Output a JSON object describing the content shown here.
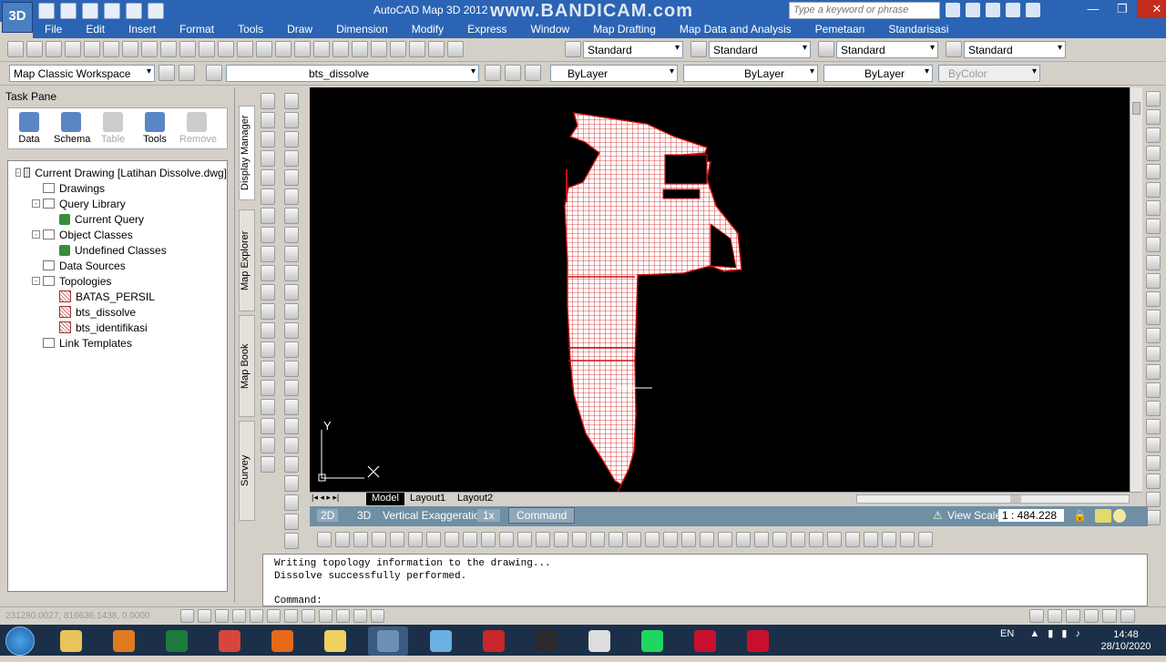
{
  "title_bar": {
    "app_title": "AutoCAD Map 3D 2012",
    "logo": "3D",
    "watermark": "www.BANDICAM.com",
    "search_placeholder": "Type a keyword or phrase"
  },
  "menu": [
    "File",
    "Edit",
    "Insert",
    "Format",
    "Tools",
    "Draw",
    "Dimension",
    "Modify",
    "Express",
    "Window",
    "Map Drafting",
    "Map Data and Analysis",
    "Pemetaan",
    "Standarisasi"
  ],
  "toolbar1": {
    "text_style": "Standard",
    "dim_style": "Standard",
    "table_style": "Standard",
    "mleader_style": "Standard"
  },
  "toolbar2": {
    "workspace": "Map Classic Workspace",
    "layer": "bts_dissolve",
    "color": "ByLayer",
    "linetype": "ByLayer",
    "lineweight": "ByLayer",
    "plotstyle": "ByColor"
  },
  "task_pane": {
    "title": "Task Pane",
    "icons": [
      {
        "label": "Data",
        "enabled": true
      },
      {
        "label": "Schema",
        "enabled": true
      },
      {
        "label": "Table",
        "enabled": false
      },
      {
        "label": "Tools",
        "enabled": true
      },
      {
        "label": "Remove",
        "enabled": false
      }
    ],
    "tree": [
      {
        "label": "Current Drawing [Latihan Dissolve.dwg]",
        "level": 0,
        "expander": "-",
        "icon": "drawing-icon"
      },
      {
        "label": "Drawings",
        "level": 1,
        "expander": "",
        "icon": "folder-icon"
      },
      {
        "label": "Query Library",
        "level": 1,
        "expander": "-",
        "icon": "folder-icon"
      },
      {
        "label": "Current Query",
        "level": 2,
        "expander": "",
        "icon": "query-icon"
      },
      {
        "label": "Object Classes",
        "level": 1,
        "expander": "-",
        "icon": "folder-icon"
      },
      {
        "label": "Undefined Classes",
        "level": 2,
        "expander": "",
        "icon": "query-icon"
      },
      {
        "label": "Data Sources",
        "level": 1,
        "expander": "",
        "icon": "folder-icon"
      },
      {
        "label": "Topologies",
        "level": 1,
        "expander": "-",
        "icon": "folder-icon"
      },
      {
        "label": "BATAS_PERSIL",
        "level": 2,
        "expander": "",
        "icon": "topology-icon"
      },
      {
        "label": "bts_dissolve",
        "level": 2,
        "expander": "",
        "icon": "topology-icon"
      },
      {
        "label": "bts_identifikasi",
        "level": 2,
        "expander": "",
        "icon": "topology-icon"
      },
      {
        "label": "Link Templates",
        "level": 1,
        "expander": "",
        "icon": "folder-icon"
      }
    ]
  },
  "side_tabs": [
    "Display Manager",
    "Map Explorer",
    "Map Book",
    "Survey"
  ],
  "layout_tabs": [
    "Model",
    "Layout1",
    "Layout2"
  ],
  "status": {
    "mode_2d": "2D",
    "mode_3d": "3D",
    "vert_exag_label": "Vertical Exaggeration:",
    "vert_exag_value": "1x",
    "command_btn": "Command",
    "view_scale_label": "View Scale",
    "view_scale_value": "1 : 484.228"
  },
  "ucs": {
    "y_label": "Y"
  },
  "command_window": {
    "lines": [
      "Writing topology information to the drawing...",
      "Dissolve successfully performed."
    ],
    "prompt": "Command:"
  },
  "coords": "231280.0027, 816636.1438, 0.0000",
  "taskbar": {
    "apps": [
      "explorer",
      "media",
      "excel",
      "chrome",
      "firefox",
      "folder",
      "autocad-map",
      "notes",
      "acrobat",
      "nox",
      "paint",
      "spotify",
      "mcafee",
      "recorder"
    ],
    "lang": "EN",
    "time": "14:48",
    "date": "28/10/2020"
  },
  "colors": {
    "titlebar": "#2b64b4",
    "canvas": "#000000",
    "parcel_fill": "#ffffff",
    "parcel_boundary": "#cc1111",
    "taskbar": "#1b3048"
  }
}
